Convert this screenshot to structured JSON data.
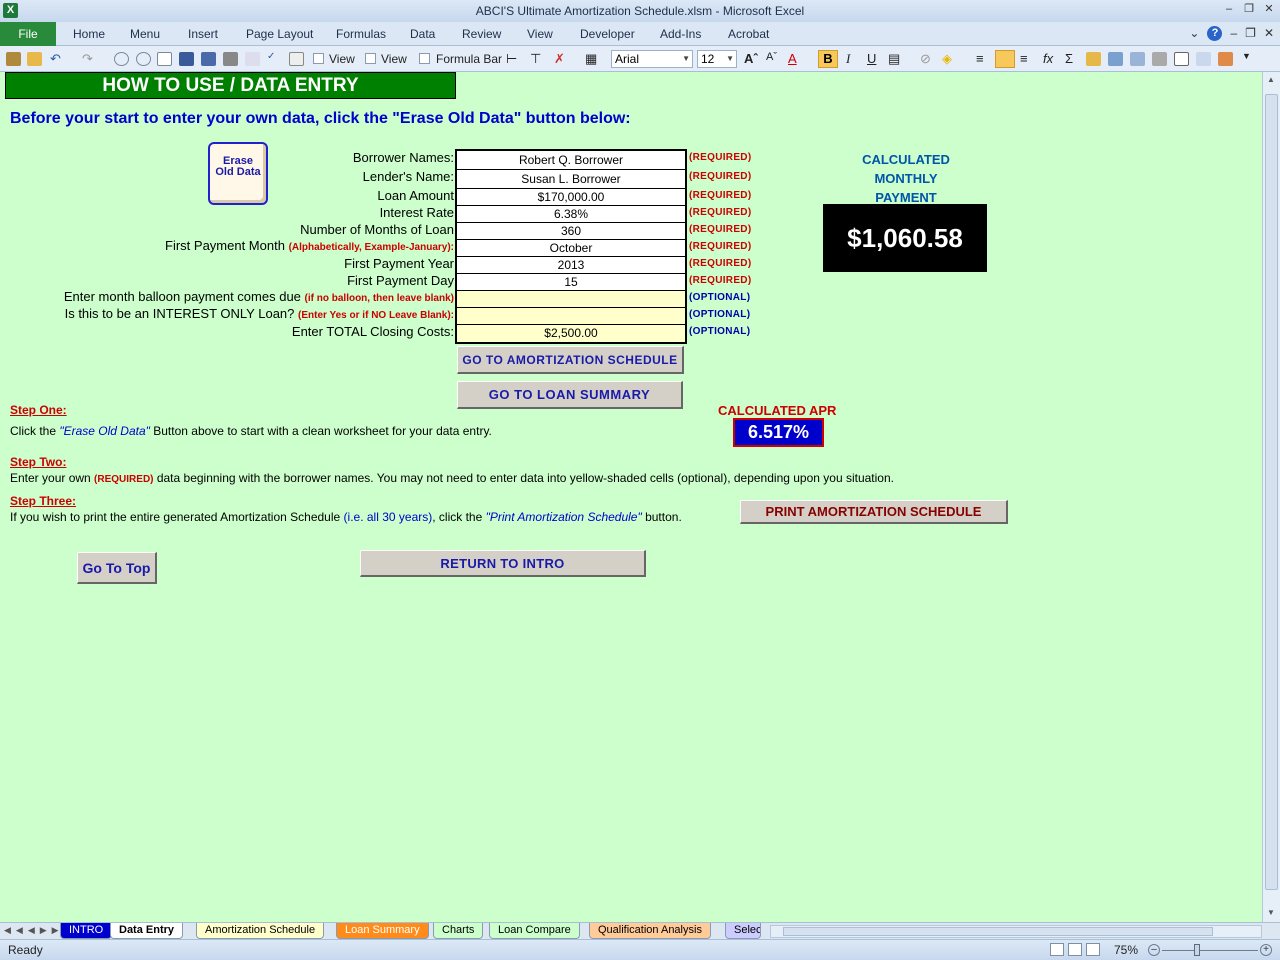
{
  "window": {
    "title": "ABCI'S Ultimate Amortization Schedule.xlsm  -  Microsoft Excel"
  },
  "ribbon": {
    "file": "File",
    "tabs": [
      "Home",
      "Menu",
      "Insert",
      "Page Layout",
      "Formulas",
      "Data",
      "Review",
      "View",
      "Developer",
      "Add-Ins",
      "Acrobat"
    ]
  },
  "toolbar": {
    "view1": "View",
    "view2": "View",
    "formula_bar": "Formula Bar",
    "font_name": "Arial",
    "font_size": "12"
  },
  "sheet": {
    "header": "HOW TO USE / DATA ENTRY",
    "intro": "Before your start to enter your own data, click the \"Erase Old Data\" button below:",
    "erase_button": "Erase Old Data",
    "form": {
      "labels": {
        "borrower": "Borrower Names:",
        "lender": "Lender's Name:",
        "amount": "Loan Amount",
        "rate": "Interest Rate",
        "months": "Number of Months of Loan",
        "month_label": "First Payment Month",
        "month_hint": "(Alphabetically, Example-January):",
        "year": "First Payment Year",
        "day": "First Payment Day",
        "balloon_label": "Enter month balloon payment comes due",
        "balloon_hint": "(if no balloon, then leave blank)",
        "io_label": "Is this to be an INTEREST ONLY Loan?",
        "io_hint": "(Enter Yes or if NO Leave Blank):",
        "closing": "Enter TOTAL Closing Costs:"
      },
      "values": {
        "borrower": "Robert Q. Borrower",
        "lender": "Susan L. Borrower",
        "amount": "$170,000.00",
        "rate": "6.38%",
        "months": "360",
        "month": "October",
        "year": "2013",
        "day": "15",
        "balloon": "",
        "io": "",
        "closing": "$2,500.00"
      },
      "required": "(REQUIRED)",
      "optional": "(OPTIONAL)"
    },
    "calculated_payment": {
      "line1": "CALCULATED",
      "line2": "MONTHLY",
      "line3": "PAYMENT",
      "value": "$1,060.58"
    },
    "buttons": {
      "amortization": "GO TO AMORTIZATION SCHEDULE",
      "summary": "GO TO LOAN SUMMARY",
      "print": "PRINT AMORTIZATION SCHEDULE",
      "top": "Go To Top",
      "return": "RETURN TO INTRO"
    },
    "apr": {
      "label": "CALCULATED APR",
      "value": "6.517%"
    },
    "steps": {
      "one_title": "Step One:",
      "one_a": "Click the ",
      "one_b": "\"Erase Old Data\"",
      "one_c": "  Button above to start with a clean worksheet for your data entry.",
      "two_title": "Step Two:",
      "two_a": "Enter your own ",
      "two_b": "(REQUIRED)",
      "two_c": " data beginning with the borrower names.  You may not need to enter data into yellow-shaded cells (optional), depending upon you situation.",
      "three_title": "Step Three:",
      "three_a": "If you wish to print the entire generated Amortization Schedule ",
      "three_b": "(i.e. all 30 years)",
      "three_c": ", click the ",
      "three_d": "\"Print Amortization Schedule\"",
      "three_e": "  button."
    }
  },
  "sheet_tabs": [
    {
      "label": "INTRO",
      "bg": "#0000cc",
      "fg": "#ffffff"
    },
    {
      "label": "Data Entry",
      "bg": "#ffffff",
      "fg": "#000000"
    },
    {
      "label": "Amortization Schedule",
      "bg": "#ffffcc",
      "fg": "#000000"
    },
    {
      "label": "Loan Summary",
      "bg": "#ff8c1a",
      "fg": "#ffffff"
    },
    {
      "label": "Charts",
      "bg": "#ccffcc",
      "fg": "#000000"
    },
    {
      "label": "Loan Compare",
      "bg": "#ccffcc",
      "fg": "#000000"
    },
    {
      "label": "Qualification Analysis",
      "bg": "#ffcc99",
      "fg": "#000000"
    },
    {
      "label": "Selec",
      "bg": "#ccccff",
      "fg": "#000000"
    }
  ],
  "status": {
    "ready": "Ready",
    "zoom": "75%"
  },
  "colors": {
    "sheet_bg": "#ccffcc",
    "header_green": "#008000",
    "required_red": "#cc0000",
    "optional_blue": "#0000aa"
  }
}
